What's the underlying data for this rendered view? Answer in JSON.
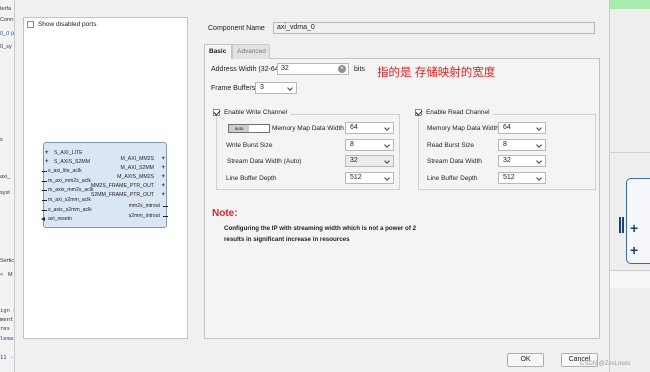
{
  "background": {
    "left_fragments": [
      "terfa",
      "Conn",
      "0_0 (A",
      "0_sy",
      "s",
      "axi_",
      "syst",
      "Sertic",
      "ign S",
      "ment",
      "res",
      "lemat",
      "11 -"
    ],
    "left_tab_arrows": [
      "<",
      "M"
    ]
  },
  "symbol": {
    "show_disabled_ports_label": "Show disabled ports",
    "show_disabled_ports_checked": false,
    "left_ports": [
      {
        "name": "S_AXI_LITE",
        "kind": "bus"
      },
      {
        "name": "S_AXIS_S2MM",
        "kind": "bus"
      },
      {
        "name": "s_axi_lite_aclk",
        "kind": "pin"
      },
      {
        "name": "m_axi_mm2s_aclk",
        "kind": "pin"
      },
      {
        "name": "m_axis_mm2s_aclk",
        "kind": "pin"
      },
      {
        "name": "m_axi_s2mm_aclk",
        "kind": "pin"
      },
      {
        "name": "s_axis_s2mm_aclk",
        "kind": "pin"
      },
      {
        "name": "axi_resetn",
        "kind": "reset"
      }
    ],
    "right_ports": [
      {
        "name": "M_AXI_MM2S",
        "kind": "bus"
      },
      {
        "name": "M_AXI_S2MM",
        "kind": "bus"
      },
      {
        "name": "M_AXIS_MM2S",
        "kind": "bus"
      },
      {
        "name": "MM2S_FRAME_PTR_OUT",
        "kind": "bus"
      },
      {
        "name": "S2MM_FRAME_PTR_OUT",
        "kind": "bus"
      },
      {
        "name": "mm2s_introut",
        "kind": "out"
      },
      {
        "name": "s2mm_introut",
        "kind": "out"
      }
    ]
  },
  "config": {
    "component_name_label": "Component Name",
    "component_name_value": "axi_vdma_0",
    "tabs": [
      {
        "label": "Basic",
        "active": true
      },
      {
        "label": "Advanced",
        "active": false
      }
    ],
    "address_width_label": "Address Width (32-64)",
    "address_width_value": "32",
    "address_width_unit": "bits",
    "frame_buffers_label": "Frame Buffers",
    "frame_buffers_value": "3",
    "annotation": "指的是 存储映射的宽度",
    "write_channel": {
      "enable_label": "Enable Write Channel",
      "enabled": true,
      "auto_switch_label": "auto",
      "memory_map_data_width_label": "Memory Map Data Width",
      "memory_map_data_width_value": "64",
      "write_burst_size_label": "Write Burst Size",
      "write_burst_size_value": "8",
      "stream_data_width_label": "Stream Data Width (Auto)",
      "stream_data_width_value": "32",
      "line_buffer_depth_label": "Line Buffer Depth",
      "line_buffer_depth_value": "512"
    },
    "read_channel": {
      "enable_label": "Enable Read Channel",
      "enabled": true,
      "memory_map_data_width_label": "Memory Map Data Width",
      "memory_map_data_width_value": "64",
      "read_burst_size_label": "Read Burst Size",
      "read_burst_size_value": "8",
      "stream_data_width_label": "Stream Data Width",
      "stream_data_width_value": "32",
      "line_buffer_depth_label": "Line Buffer Depth",
      "line_buffer_depth_value": "512"
    },
    "note_title": "Note:",
    "note_line1": "Configuring the IP with streaming width which is not a power of 2",
    "note_line2": "results in significant increase in resources"
  },
  "buttons": {
    "ok": "OK",
    "cancel": "Cancel"
  },
  "watermark": "CSDN @ZxsLoves",
  "colors": {
    "note_red": "#e02020",
    "block_fill": "#dbe6f4",
    "green_strip": "#a7ecac"
  }
}
